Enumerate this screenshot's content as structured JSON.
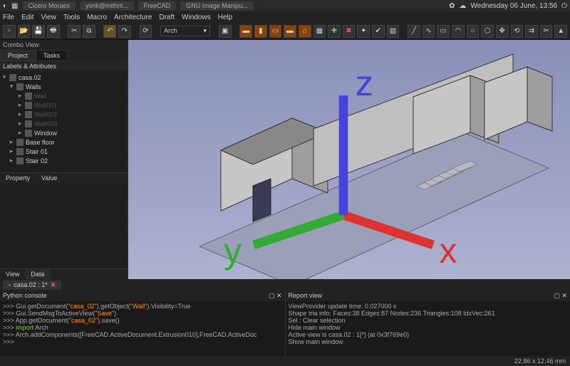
{
  "titlebar": {
    "tabs": [
      "Cicero Moraes",
      "yorik@mithril...",
      "FreeCAD",
      "GNU Image Manipu..."
    ],
    "clock": "Wednesday 06 June, 13:56"
  },
  "menu": {
    "items": [
      "File",
      "Edit",
      "View",
      "Tools",
      "Macro",
      "Architecture",
      "Draft",
      "Windows",
      "Help"
    ]
  },
  "module_dropdown": "Arch",
  "combo": {
    "label": "Combo View",
    "tabs": [
      "Project",
      "Tasks"
    ],
    "labels_hdr": "Labels & Attributes"
  },
  "tree": {
    "root": "casa.02",
    "walls": "Walls",
    "wall_items": [
      "Wall",
      "Wall001",
      "Wall002",
      "Wall003",
      "Window"
    ],
    "others": [
      "Base floor",
      "Stair 01",
      "Stair 02"
    ]
  },
  "properties": {
    "cols": [
      "Property",
      "Value"
    ],
    "tabs": [
      "View",
      "Data"
    ]
  },
  "doc_tab": "casa.02 : 1*",
  "console": {
    "title": "Python console",
    "lines": [
      ">>> Gui.getDocument(\"casa_02\").getObject(\"Wall\").Visibility=True",
      ">>> Gui.SendMsgToActiveView(\"Save\")",
      ">>> App.getDocument(\"casa_02\").save()",
      ">>> import Arch",
      ">>> Arch.addComponents([FreeCAD.ActiveDocument.Extrusion010],FreeCAD.ActiveDoc",
      ">>> "
    ]
  },
  "report": {
    "title": "Report view",
    "lines": [
      "ViewProvider update time: 0.027000 s",
      "Shape tria info: Faces:38 Edges:87 Nodes:236 Triangles:108 IdxVec:261",
      "Sel : Clear selection",
      "Hide main window",
      "Active view is casa.02 : 1[*] (at 0x3f769e0)",
      "Show main window"
    ]
  },
  "status": "22.86 x 12.46 mm"
}
